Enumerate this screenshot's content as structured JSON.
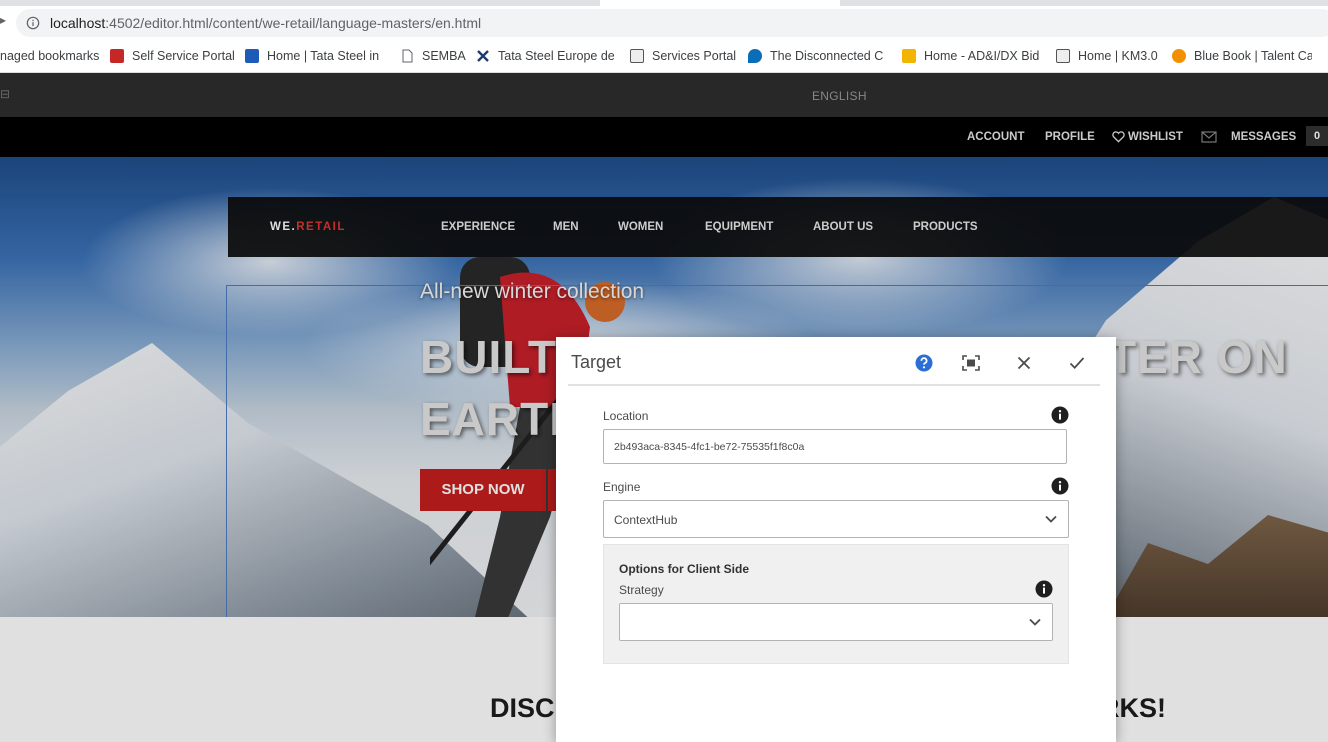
{
  "browser": {
    "left_glyph": "▸",
    "url_host": "localhost",
    "url_rest": ":4502/editor.html/content/we-retail/language-masters/en.html",
    "bookmarks": [
      {
        "label": "naged bookmarks",
        "icon": "none"
      },
      {
        "label": "Self Service Portal",
        "icon": "good-favicon"
      },
      {
        "label": "Home | Tata Steel in E",
        "icon": "tata-favicon"
      },
      {
        "label": "SEMBA",
        "icon": "page-icon"
      },
      {
        "label": "Tata Steel Europe der",
        "icon": "x-favicon"
      },
      {
        "label": "Services Portal",
        "icon": "portal-favicon"
      },
      {
        "label": "The Disconnected Cu",
        "icon": "cloud-favicon"
      },
      {
        "label": "Home - AD&I/DX Bid",
        "icon": "folder-favicon"
      },
      {
        "label": "Home | KM3.0",
        "icon": "portal-favicon"
      },
      {
        "label": "Blue Book | Talent Ca",
        "icon": "orange-favicon"
      }
    ]
  },
  "page": {
    "lang_mark": "⊟",
    "language": "ENGLISH",
    "account_links": {
      "account": "ACCOUNT",
      "profile": "PROFILE",
      "wishlist": "WISHLIST",
      "messages": "MESSAGES",
      "message_count": "0"
    },
    "logo": {
      "we": "WE.",
      "retail": "RETAIL"
    },
    "nav": [
      "EXPERIENCE",
      "MEN",
      "WOMEN",
      "EQUIPMENT",
      "ABOUT US",
      "PRODUCTS"
    ],
    "hero": {
      "subtitle": "All-new winter collection",
      "title_line1_left": "BUILT",
      "title_line1_right": "TER ON",
      "title_line2_left": "EARTH",
      "shop_now": "SHOP NOW"
    },
    "discover_left": "DISC",
    "discover_right": "RKS!"
  },
  "dialog": {
    "title": "Target",
    "location_label": "Location",
    "location_value": "2b493aca-8345-4fc1-be72-75535f1f8c0a",
    "engine_label": "Engine",
    "engine_value": "ContextHub",
    "options_heading": "Options for Client Side",
    "strategy_label": "Strategy",
    "strategy_value": ""
  },
  "colors": {
    "brand_red": "#c41e1e",
    "logo_red": "#e23535",
    "help_blue": "#2b6fd6",
    "frame_blue": "#4d7cc3"
  }
}
